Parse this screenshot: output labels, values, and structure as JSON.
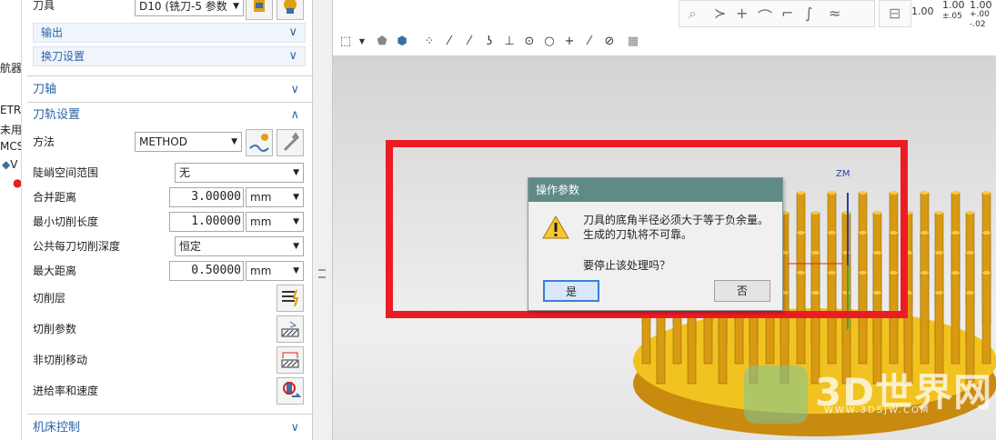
{
  "left_strip": {
    "lines": [
      "导航器",
      "ETR",
      "未用",
      "MCS",
      "V"
    ]
  },
  "panel": {
    "tool_label": "刀具",
    "tool_value": "D10 (铣刀-5 参数",
    "output_label": "输出",
    "tool_change_label": "换刀设置",
    "axis_label": "刀轴",
    "path_settings_label": "刀轨设置",
    "method_label": "方法",
    "method_value": "METHOD",
    "steep_label": "陡峭空间范围",
    "steep_value": "无",
    "merge_label": "合并距离",
    "merge_value": "3.00000",
    "merge_unit": "mm",
    "min_cut_label": "最小切削长度",
    "min_cut_value": "1.00000",
    "min_cut_unit": "mm",
    "depth_label": "公共每刀切削深度",
    "depth_value": "恒定",
    "max_dist_label": "最大距离",
    "max_dist_value": "0.50000",
    "max_dist_unit": "mm",
    "cut_layers_label": "切削层",
    "cut_params_label": "切削参数",
    "non_cut_label": "非切削移动",
    "feeds_label": "进给率和速度",
    "machine_ctrl_label": "机床控制"
  },
  "toolbar": {
    "readout1": "1.00",
    "readout2_top": "1.00",
    "readout2_bottom": "±.05",
    "readout3_top": "1.00",
    "readout3_mid": "+.00",
    "readout3_bottom": "-.02"
  },
  "viewport": {
    "axis_label": "ZM",
    "watermark": "3D世界网",
    "watermark_sub": "WWW.3DSJW.COM"
  },
  "dialog": {
    "title": "操作参数",
    "line1": "刀具的底角半径必须大于等于负余量。",
    "line2": "生成的刀轨将不可靠。",
    "question": "要停止该处理吗？",
    "yes_label": "是",
    "no_label": "否"
  },
  "colors": {
    "highlight": "#ec1c24",
    "dialog_title": "#5f8a86",
    "part": "#e0a010"
  }
}
